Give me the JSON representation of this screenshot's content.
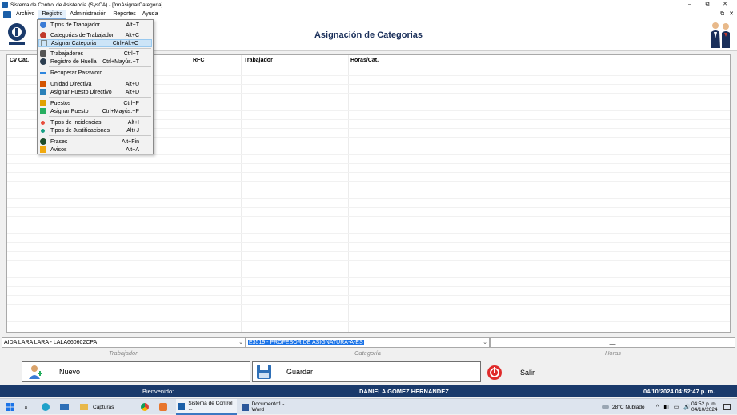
{
  "window": {
    "title": "Sistema de Control de Asistencia (SysCA) - [frmAsignarCategoria]",
    "controls": [
      "–",
      "⧉",
      "✕"
    ],
    "mdi_controls": [
      "–",
      "⧉",
      "✕"
    ]
  },
  "menubar": {
    "items": [
      "Archivo",
      "Registro",
      "Administración",
      "Reportes",
      "Ayuda"
    ]
  },
  "header": {
    "title": "Asignación de Categorias"
  },
  "grid": {
    "columns": [
      "Cv Cat.",
      "",
      "RFC",
      "Trabajador",
      "Horas/Cat."
    ]
  },
  "form": {
    "trabajador_value": "AIDA LARA LARA - LALA660602CPA",
    "categoria_value": "E3519 - PROFESOR DE ASIGNATURA-A-ES",
    "horas_value": "__",
    "labels": {
      "trabajador": "Trabajador",
      "categoria": "Categoría",
      "horas": "Horas"
    }
  },
  "buttons": {
    "nuevo": "Nuevo",
    "guardar": "Guardar",
    "salir": "Salir"
  },
  "status": {
    "welcome": "Bienvenido:",
    "user": "DANIELA GOMEZ HERNANDEZ",
    "datetime": "04/10/2024 04:52:47 p. m."
  },
  "registro_menu": {
    "items": [
      {
        "label": "Tipos de Trabajador",
        "shortcut": "Alt+T",
        "icon": "user-type-icon",
        "color": "#3a7bd5"
      },
      {
        "label": "Categorias de Trabajador",
        "shortcut": "Alt+C",
        "icon": "category-icon",
        "color": "#c0392b"
      },
      {
        "label": "Asignar Categoria",
        "shortcut": "Ctrl+Alt+C",
        "icon": "assign-category-icon",
        "color": "#7f8c8d"
      },
      {
        "label": "Trabajadores",
        "shortcut": "Ctrl+T",
        "icon": "workers-icon",
        "color": "#555555"
      },
      {
        "label": "Registro de Huella",
        "shortcut": "Ctrl+Mayús.+T",
        "icon": "fingerprint-icon",
        "color": "#2c3e50"
      },
      {
        "label": "Recuperar Password",
        "shortcut": "",
        "icon": "key-icon",
        "color": "#2e86de"
      },
      {
        "label": "Unidad Directiva",
        "shortcut": "Alt+U",
        "icon": "house-icon",
        "color": "#d35400"
      },
      {
        "label": "Asignar Puesto Directivo",
        "shortcut": "Alt+D",
        "icon": "flag-icon",
        "color": "#2980b9"
      },
      {
        "label": "Puestos",
        "shortcut": "Ctrl+P",
        "icon": "position-icon",
        "color": "#e1a100"
      },
      {
        "label": "Asignar Puesto",
        "shortcut": "Ctrl+Mayús.+P",
        "icon": "assign-position-icon",
        "color": "#27ae60"
      },
      {
        "label": "Tipos de Incidencias",
        "shortcut": "Alt+I",
        "icon": "incident-icon",
        "color": "#e74c3c"
      },
      {
        "label": "Tipos de Justificaciones",
        "shortcut": "Alt+J",
        "icon": "justification-icon",
        "color": "#16a085"
      },
      {
        "label": "Frases",
        "shortcut": "Alt+Fin",
        "icon": "phrase-icon",
        "color": "#1e4d2b"
      },
      {
        "label": "Avisos",
        "shortcut": "Alt+A",
        "icon": "notice-icon",
        "color": "#f1a90f"
      }
    ]
  },
  "taskbar": {
    "capturas": "Capturas",
    "app": "Sistema de Control ...",
    "word": "Documento1 - Word",
    "weather": "28°C  Nublado",
    "time": "04:52 p. m.",
    "date": "04/10/2024"
  }
}
